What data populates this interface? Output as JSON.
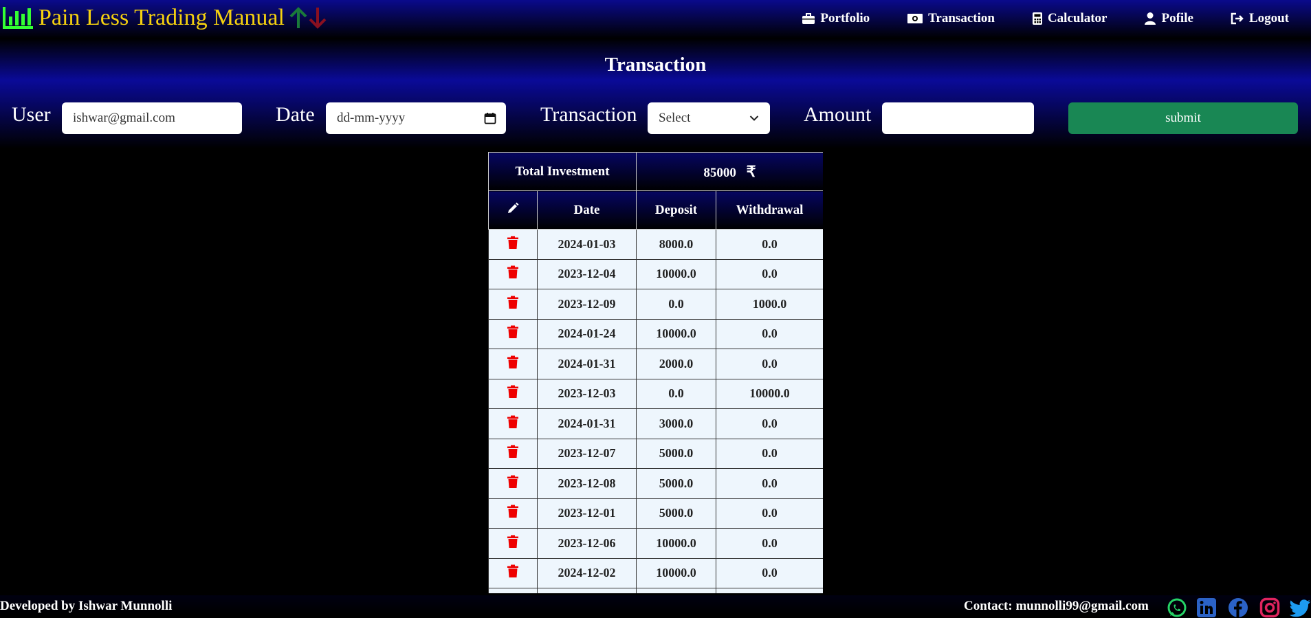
{
  "brand": {
    "title": "Pain Less Trading Manual",
    "icon": "bar-chart-icon"
  },
  "nav": [
    {
      "label": "Portfolio",
      "icon": "briefcase-icon"
    },
    {
      "label": "Transaction",
      "icon": "money-icon"
    },
    {
      "label": "Calculator",
      "icon": "calculator-icon"
    },
    {
      "label": "Pofile",
      "icon": "user-icon"
    },
    {
      "label": "Logout",
      "icon": "logout-icon"
    }
  ],
  "page_title": "Transaction",
  "form": {
    "user_label": "User",
    "user_value": "ishwar@gmail.com",
    "date_label": "Date",
    "date_placeholder": "dd-mm-yyyy",
    "transaction_label": "Transaction",
    "transaction_selected": "Select",
    "amount_label": "Amount",
    "amount_value": "",
    "submit_label": "submit"
  },
  "table": {
    "total_label": "Total Investment",
    "total_value": "85000",
    "currency": "₹",
    "columns": [
      "Date",
      "Deposit",
      "Withdrawal"
    ],
    "rows": [
      {
        "date": "2024-01-03",
        "deposit": "8000.0",
        "withdrawal": "0.0"
      },
      {
        "date": "2023-12-04",
        "deposit": "10000.0",
        "withdrawal": "0.0"
      },
      {
        "date": "2023-12-09",
        "deposit": "0.0",
        "withdrawal": "1000.0"
      },
      {
        "date": "2024-01-24",
        "deposit": "10000.0",
        "withdrawal": "0.0"
      },
      {
        "date": "2024-01-31",
        "deposit": "2000.0",
        "withdrawal": "0.0"
      },
      {
        "date": "2023-12-03",
        "deposit": "0.0",
        "withdrawal": "10000.0"
      },
      {
        "date": "2024-01-31",
        "deposit": "3000.0",
        "withdrawal": "0.0"
      },
      {
        "date": "2023-12-07",
        "deposit": "5000.0",
        "withdrawal": "0.0"
      },
      {
        "date": "2023-12-08",
        "deposit": "5000.0",
        "withdrawal": "0.0"
      },
      {
        "date": "2023-12-01",
        "deposit": "5000.0",
        "withdrawal": "0.0"
      },
      {
        "date": "2023-12-06",
        "deposit": "10000.0",
        "withdrawal": "0.0"
      },
      {
        "date": "2024-12-02",
        "deposit": "10000.0",
        "withdrawal": "0.0"
      }
    ]
  },
  "footer": {
    "developer": "Developed by Ishwar Munnolli",
    "contact": "Contact: munnolli99@gmail.com",
    "social": [
      "whatsapp-icon",
      "linkedin-icon",
      "facebook-icon",
      "instagram-icon",
      "twitter-icon"
    ]
  },
  "colors": {
    "brand": "#f5d10f",
    "submit": "#198754",
    "delete": "#ee0000",
    "up_arrow": "#1a7a3a",
    "down_arrow": "#8a1020"
  }
}
